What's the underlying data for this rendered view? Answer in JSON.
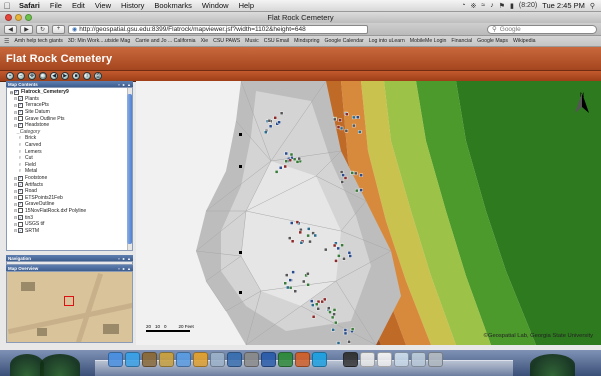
{
  "menubar": {
    "app": "Safari",
    "items": [
      "File",
      "Edit",
      "View",
      "History",
      "Bookmarks",
      "Window",
      "Help"
    ],
    "clock": "Tue 2:45 PM",
    "battery": "(8:20)"
  },
  "browser": {
    "window_title": "Flat Rock Cemetery",
    "url": "http://geospatial.gsu.edu:8399/Flatrock/mapviewer.jsf?width=1102&height=648",
    "search_placeholder": "Google",
    "bookmarks": [
      "Amh help tech giants",
      "3D: Min Work....utside Mag",
      "Carrie and Jo ... California",
      "Xie",
      "CSU PAWS",
      "Music",
      "CSU Email",
      "Mindspring",
      "Google Calendar",
      "Log into uLearn",
      "MobileMe Login",
      "Financial",
      "Google Maps",
      "Wikipedia"
    ]
  },
  "app": {
    "title": "Flat Rock Cemetery"
  },
  "panels": {
    "contents_title": "Map Contents",
    "navigation_title": "Navigation",
    "overview_title": "Map Overview",
    "panel_controls": "▪ ▸ ▴"
  },
  "layers": [
    {
      "label": "Flatrock_Cemetery9",
      "kind": "root",
      "checked": true,
      "indent": 0
    },
    {
      "label": "Plants",
      "kind": "layer",
      "checked": true,
      "indent": 1
    },
    {
      "label": "TerracePts",
      "kind": "layer",
      "checked": true,
      "indent": 1
    },
    {
      "label": "Site Datum",
      "kind": "layer",
      "checked": true,
      "indent": 1
    },
    {
      "label": "Grave Outline Pts",
      "kind": "layer",
      "checked": false,
      "indent": 1
    },
    {
      "label": "Headstone",
      "kind": "layer",
      "checked": true,
      "indent": 1
    },
    {
      "label": "_Category",
      "kind": "sublabel",
      "checked": null,
      "indent": 2
    },
    {
      "label": "Brick",
      "kind": "legend",
      "checked": null,
      "indent": 2
    },
    {
      "label": "Carved",
      "kind": "legend",
      "checked": null,
      "indent": 2
    },
    {
      "label": "Lemers",
      "kind": "legend",
      "checked": null,
      "indent": 2
    },
    {
      "label": "Cut",
      "kind": "legend",
      "checked": null,
      "indent": 2
    },
    {
      "label": "Field",
      "kind": "legend",
      "checked": null,
      "indent": 2
    },
    {
      "label": "Metal",
      "kind": "legend",
      "checked": null,
      "indent": 2
    },
    {
      "label": "Footstone",
      "kind": "layer",
      "checked": true,
      "indent": 1
    },
    {
      "label": "Artifacts",
      "kind": "layer",
      "checked": true,
      "indent": 1
    },
    {
      "label": "Road",
      "kind": "layer",
      "checked": true,
      "indent": 1
    },
    {
      "label": "ETSPoints21Feb",
      "kind": "layer",
      "checked": false,
      "indent": 1
    },
    {
      "label": "GraveOutline",
      "kind": "layer",
      "checked": true,
      "indent": 1
    },
    {
      "label": "15NovFlatRock.dxf Polyline",
      "kind": "layer",
      "checked": false,
      "indent": 1
    },
    {
      "label": "tin3",
      "kind": "layer",
      "checked": true,
      "indent": 1
    },
    {
      "label": "USGS tif",
      "kind": "layer",
      "checked": false,
      "indent": 1
    },
    {
      "label": "SRTM",
      "kind": "layer",
      "checked": true,
      "indent": 1
    }
  ],
  "map": {
    "north_label": "N",
    "scale_labels": [
      "20",
      "10",
      "0",
      "20 Feet"
    ],
    "credit": "©Geospatial Lab, Georgia State University"
  },
  "colors": {
    "header": "#b4522a",
    "panel_header": "#4a6a9c",
    "terrain": [
      "#7a3e1e",
      "#9a5020",
      "#c06a28",
      "#d88a3c",
      "#c9c24e",
      "#9cc248",
      "#4d9a2c",
      "#2e7a1f"
    ]
  }
}
